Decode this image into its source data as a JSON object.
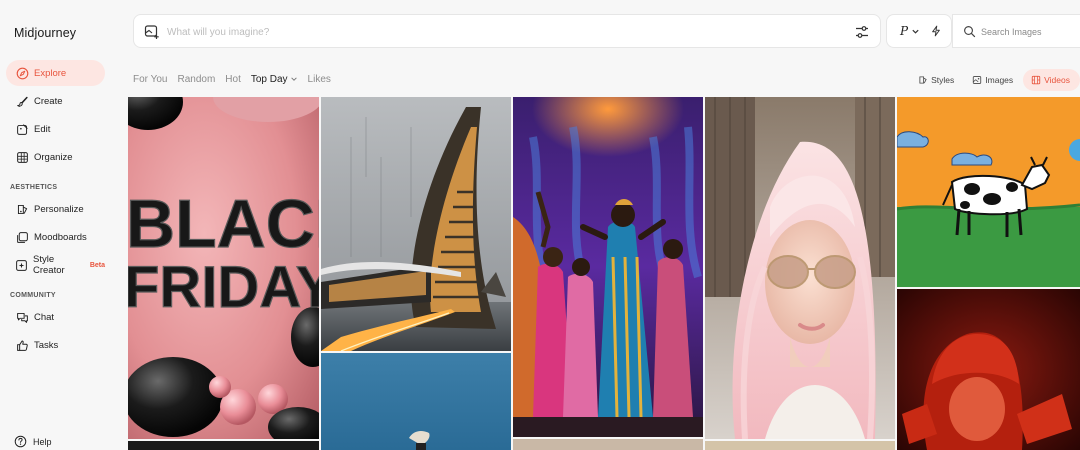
{
  "brand": "Midjourney",
  "sidebar": {
    "items": [
      {
        "label": "Explore",
        "icon": "compass-icon",
        "active": true
      },
      {
        "label": "Create",
        "icon": "brush-icon"
      },
      {
        "label": "Edit",
        "icon": "edit-image-icon"
      },
      {
        "label": "Organize",
        "icon": "grid-icon"
      }
    ],
    "aesthetics_label": "AESTHETICS",
    "aesthetics_items": [
      {
        "label": "Personalize",
        "icon": "palette-icon"
      },
      {
        "label": "Moodboards",
        "icon": "moodboard-icon"
      },
      {
        "label": "Style Creator",
        "icon": "style-creator-icon",
        "badge": "Beta"
      }
    ],
    "community_label": "COMMUNITY",
    "community_items": [
      {
        "label": "Chat",
        "icon": "chat-icon"
      },
      {
        "label": "Tasks",
        "icon": "thumbs-up-icon"
      }
    ],
    "help_label": "Help"
  },
  "prompt": {
    "placeholder": "What will you imagine?"
  },
  "mode": {
    "label": "P"
  },
  "search": {
    "placeholder": "Search Images"
  },
  "tabs": [
    "For You",
    "Random",
    "Hot",
    "Top Day",
    "Likes"
  ],
  "active_tab": "Top Day",
  "filters": {
    "styles": "Styles",
    "images": "Images",
    "videos": "Videos"
  },
  "colors": {
    "accent": "#e8553e",
    "accent_bg": "#fde6e2"
  },
  "gallery": {
    "tile_text": {
      "black_friday_line1": "BLACK",
      "black_friday_line2": "FRIDAY"
    }
  }
}
